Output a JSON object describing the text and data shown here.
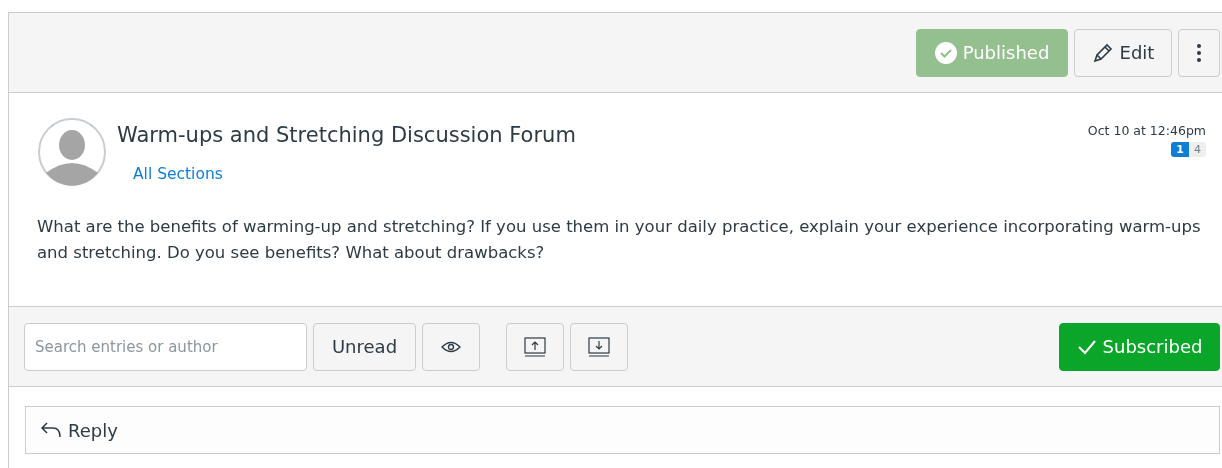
{
  "header": {
    "publish_button": {
      "label": "Published",
      "published": true
    },
    "edit_button": {
      "label": "Edit"
    }
  },
  "topic": {
    "title": "Warm-ups and Stretching Discussion Forum",
    "sections_link": "All Sections",
    "date": "Oct 10 at 12:46pm",
    "unread_count": "1",
    "total_count": "4",
    "message": "What are the benefits of warming-up and stretching? If you use them in your daily practice, explain your experience incorporating warm-ups and stretching. Do you see benefits? What about drawbacks?"
  },
  "toolbar": {
    "search": {
      "placeholder": "Search entries or author"
    },
    "unread_button": {
      "label": "Unread",
      "selected": false
    },
    "subscribe_button": {
      "label": "Subscribed",
      "subscribed": true
    }
  },
  "reply": {
    "label": "Reply"
  }
}
